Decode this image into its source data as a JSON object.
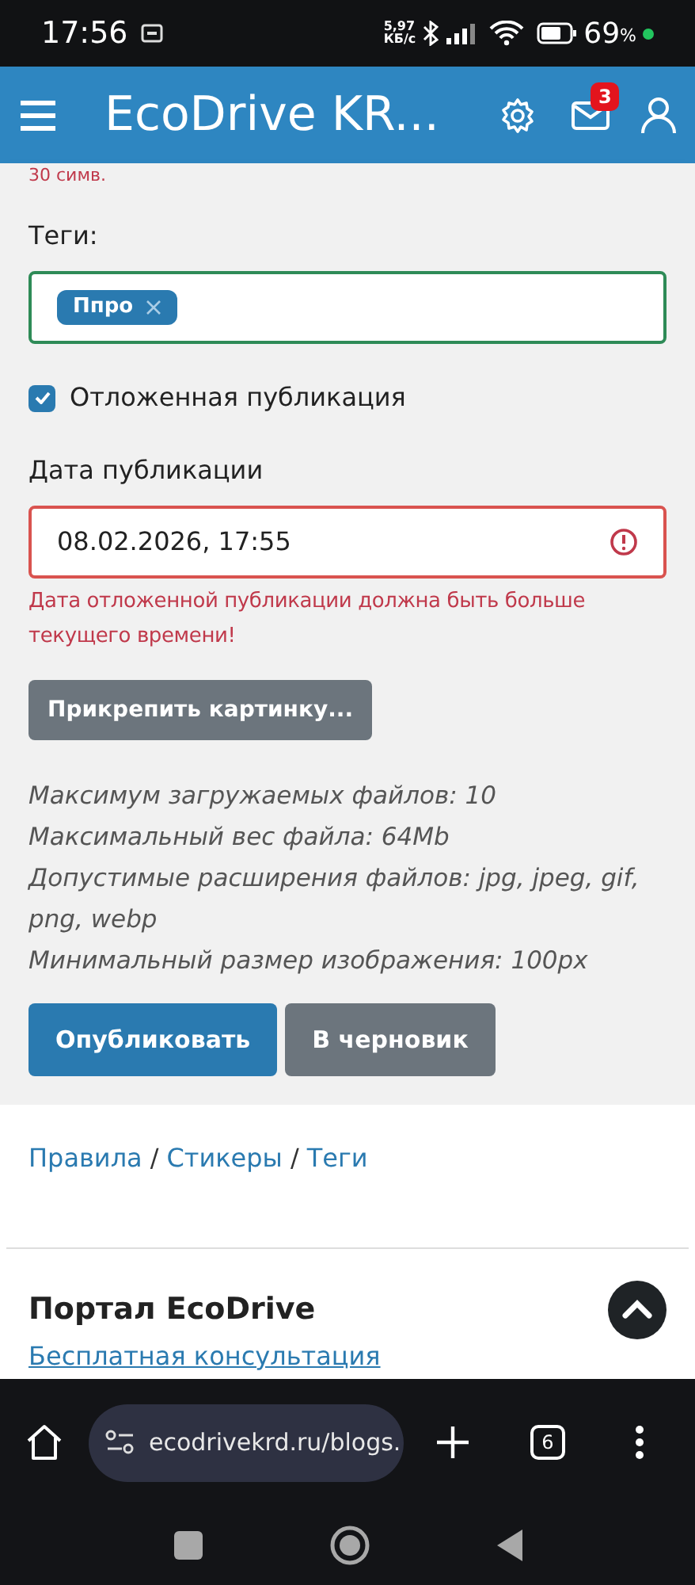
{
  "status_bar": {
    "time": "17:56",
    "speed": "5,97",
    "speed_unit": "КБ/с",
    "battery": "69",
    "battery_unit": "%"
  },
  "header": {
    "title": "EcoDrive KR...",
    "mail_badge": "3"
  },
  "form": {
    "counter_note": "30 симв.",
    "tags_label": "Теги:",
    "tags": [
      {
        "label": "Ппро"
      }
    ],
    "deferred": {
      "label": "Отложенная публикация",
      "checked": true
    },
    "date_label": "Дата публикации",
    "date_value": "08.02.2026, 17:55",
    "date_invalid": true,
    "date_error": "Дата отложенной публикации должна быть больше текущего времени!",
    "attach_button": "Прикрепить картинку...",
    "notes": [
      "Максимум загружаемых файлов: 10",
      "Максимальный вес файла: 64Mb",
      "Допустимые расширения файлов: jpg, jpeg, gif, png, webp",
      "Минимальный размер изображения: 100px"
    ],
    "buttons": [
      {
        "label": "Опубликовать",
        "kind": "primary"
      },
      {
        "label": "В черновик",
        "kind": "secondary"
      }
    ]
  },
  "breadcrumbs": {
    "separator": "/",
    "items": [
      "Правила",
      "Стикеры",
      "Теги"
    ]
  },
  "footer": {
    "title": "Портал EcoDrive",
    "link": "Бесплатная консультация"
  },
  "browser": {
    "url": "ecodrivekrd.ru/blogs.",
    "tab_count": "6"
  }
}
